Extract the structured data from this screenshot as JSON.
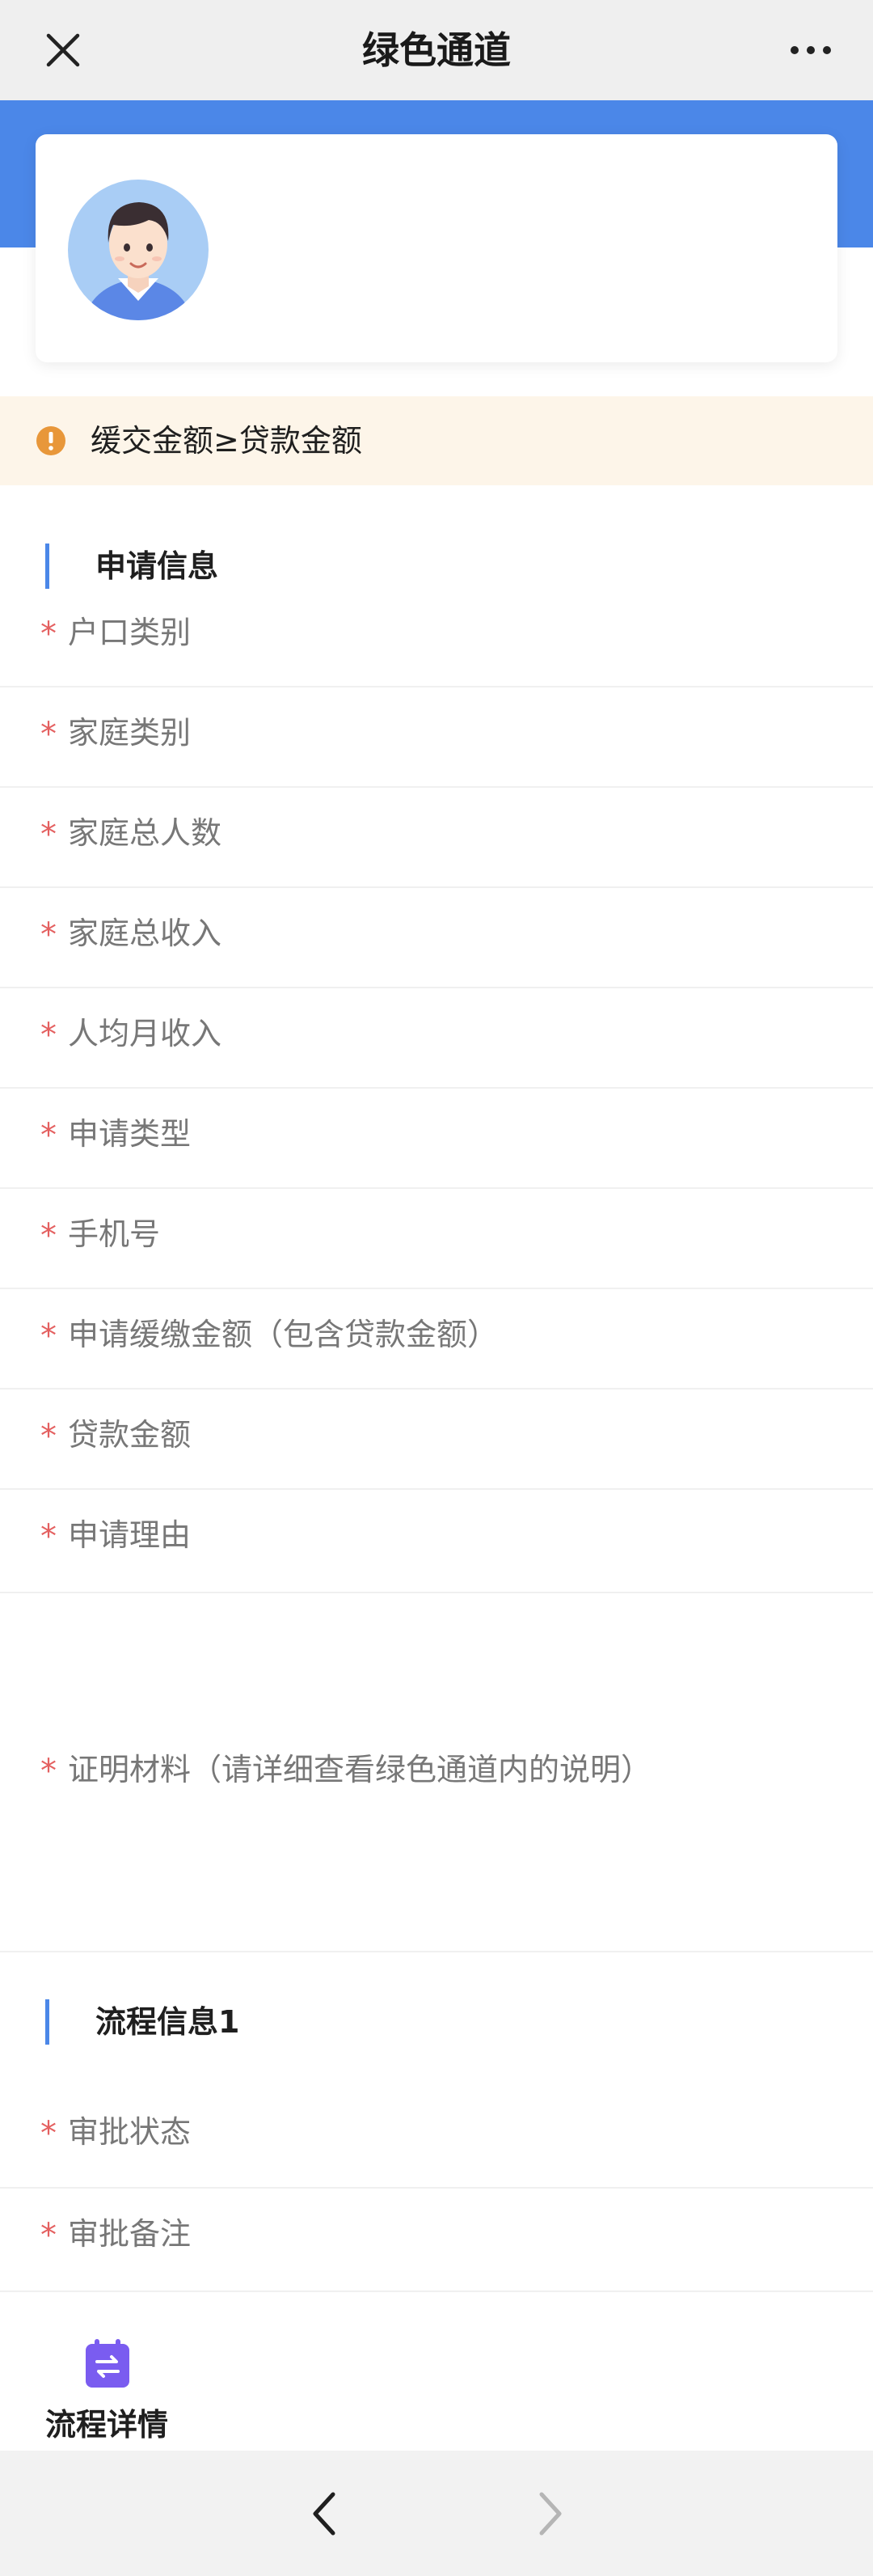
{
  "nav": {
    "title": "绿色通道",
    "close_icon": "close-icon",
    "more_icon": "more-dots-icon"
  },
  "notice": {
    "icon": "warning-icon",
    "text": "缓交金额≥贷款金额"
  },
  "sections": {
    "apply_title": "申请信息",
    "flow_title": "流程信息1"
  },
  "required_mark": "*",
  "apply_fields": [
    "户口类别",
    "家庭类别",
    "家庭总人数",
    "家庭总收入",
    "人均月收入",
    "申请类型",
    "手机号",
    "申请缓缴金额（包含贷款金额）",
    "贷款金额",
    "申请理由",
    "证明材料（请详细查看绿色通道内的说明）"
  ],
  "flow_fields": [
    "审批状态",
    "审批备注"
  ],
  "flow_detail": {
    "icon": "flow-swap-icon",
    "label": "流程详情"
  },
  "bottom_nav": {
    "back_icon": "chevron-left-icon",
    "forward_icon": "chevron-right-icon"
  },
  "colors": {
    "accent": "#4b87e8",
    "required": "#e46060",
    "notice_bg": "#fdf5e9",
    "notice_icon": "#e8973a",
    "flow_icon": "#7a5cf0"
  }
}
